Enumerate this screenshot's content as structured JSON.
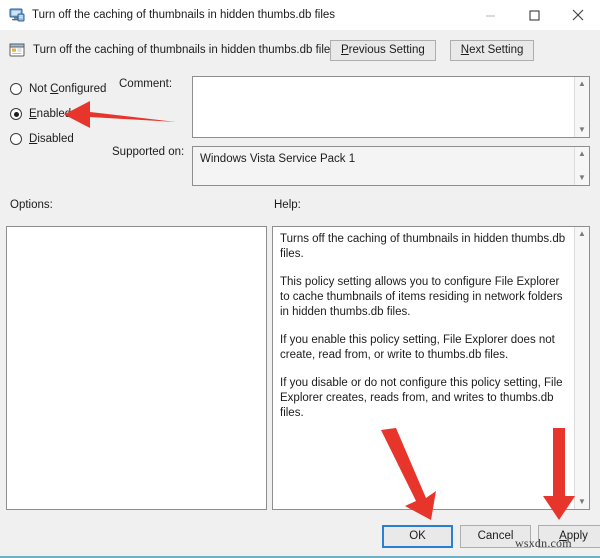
{
  "window": {
    "title": "Turn off the caching of thumbnails in hidden thumbs.db files",
    "title_icon": "computer-policy-icon",
    "caption": {
      "minimize": "minimize-icon",
      "maximize": "maximize-icon",
      "close": "close-icon"
    },
    "accent_focus_color": "#2a7fd4",
    "bottom_edge_color": "#6fb0c4"
  },
  "header": {
    "icon": "policy-setting-icon",
    "setting_name": "Turn off the caching of thumbnails in hidden thumbs.db files",
    "previous_button": "Previous Setting",
    "previous_accelerator": "P",
    "next_button": "Next Setting",
    "next_accelerator": "N"
  },
  "state": {
    "options": [
      {
        "label": "Not Configured",
        "accelerator": "C",
        "selected": false
      },
      {
        "label": "Enabled",
        "accelerator": "E",
        "selected": true
      },
      {
        "label": "Disabled",
        "accelerator": "D",
        "selected": false
      }
    ]
  },
  "comment": {
    "label": "Comment:",
    "value": "",
    "placeholder": ""
  },
  "supported_on": {
    "label": "Supported on:",
    "value": "Windows Vista Service Pack 1"
  },
  "options_panel": {
    "label": "Options:",
    "value": ""
  },
  "help_panel": {
    "label": "Help:",
    "paragraphs": [
      "Turns off the caching of thumbnails in hidden thumbs.db files.",
      "This policy setting allows you to configure File Explorer to cache thumbnails of items residing in network folders in hidden thumbs.db files.",
      "If you enable this policy setting, File Explorer does not create, read from, or write to thumbs.db files.",
      "If you disable or do not configure this policy setting, File Explorer creates, reads from, and writes to thumbs.db files."
    ]
  },
  "footer": {
    "ok_button": "OK",
    "cancel_button": "Cancel",
    "apply_button": "Apply",
    "apply_accelerator": "A",
    "default_button": "OK"
  },
  "annotations": {
    "arrow_color": "#e8352b",
    "arrow_enabled_target": "Enabled",
    "arrow_ok_target": "OK",
    "arrow_apply_target": "Apply"
  },
  "watermark": {
    "text": "wsxdn.com"
  }
}
